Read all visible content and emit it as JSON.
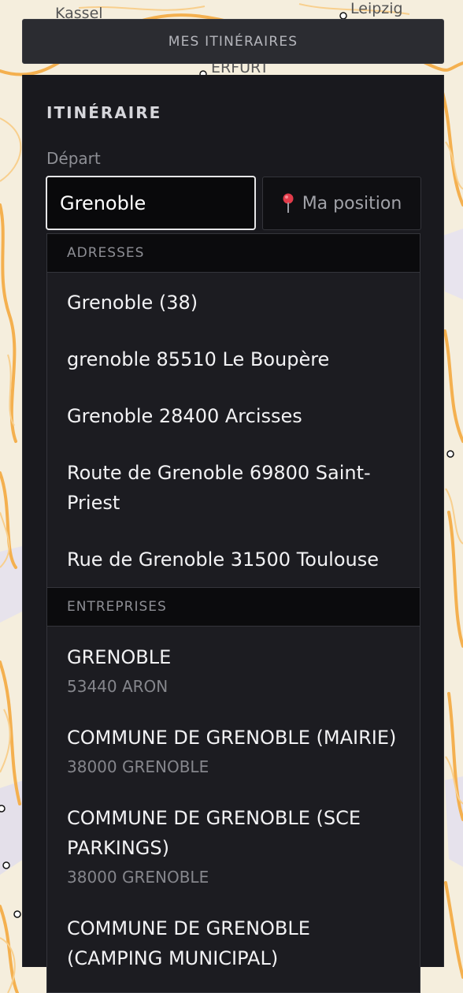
{
  "map": {
    "labels": [
      "Kassel",
      "Leipzig",
      "ERFURT"
    ]
  },
  "header": {
    "trips_label": "Mes itinéraires"
  },
  "panel": {
    "title": "Itinéraire",
    "depart_label": "Départ",
    "depart_value": "Grenoble",
    "position_label": "Ma position",
    "position_icon": "pin-icon"
  },
  "suggestions": {
    "addresses_header": "Adresses",
    "addresses": [
      "Grenoble (38)",
      "grenoble 85510 Le Boupère",
      "Grenoble 28400 Arcisses",
      "Route de Grenoble 69800 Saint-Priest",
      "Rue de Grenoble 31500 Toulouse"
    ],
    "companies_header": "Entreprises",
    "companies": [
      {
        "name": "GRENOBLE",
        "location": "53440 ARON"
      },
      {
        "name": "COMMUNE DE GRENOBLE (MAIRIE)",
        "location": "38000 GRENOBLE"
      },
      {
        "name": "COMMUNE DE GRENOBLE (SCE PARKINGS)",
        "location": "38000 GRENOBLE"
      },
      {
        "name": "COMMUNE DE GRENOBLE (CAMPING MUNICIPAL)",
        "location": ""
      }
    ]
  },
  "colors": {
    "panel_bg": "#19191e",
    "dropdown_bg": "#1c1c21",
    "header_bg": "#0b0b0d",
    "map_bg": "#f4ecd9",
    "road": "#f5b456"
  }
}
